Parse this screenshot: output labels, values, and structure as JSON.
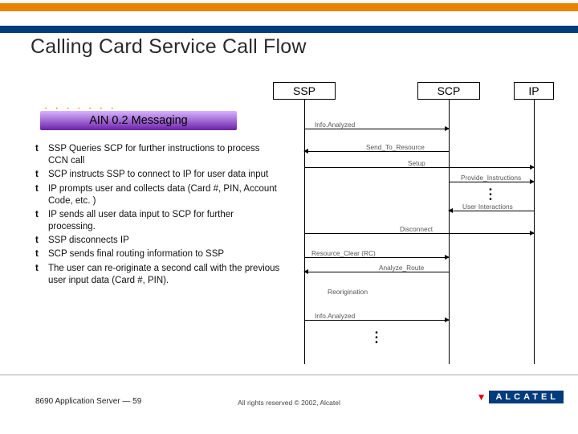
{
  "title": "Calling Card Service Call Flow",
  "subtitle": "AIN 0.2 Messaging",
  "actors": {
    "ssp": "SSP",
    "scp": "SCP",
    "ip": "IP"
  },
  "bullets": [
    "SSP Queries SCP for further instructions to process CCN call",
    "SCP instructs SSP to connect to IP for user data input",
    "IP prompts user and collects data (Card #, PIN, Account Code, etc. )",
    "IP sends all user data input to SCP for further processing.",
    "SSP disconnects IP",
    "SCP sends final routing information to SSP",
    "The user can re-originate a second call with the previous user input data (Card #, PIN)."
  ],
  "messages": {
    "m1": "Info.Analyzed",
    "m2": "Send_To_Resource",
    "m3": "Setup",
    "m4": "Provide_Instructions",
    "m5": "User Interactions",
    "m6": "Disconnect",
    "m7": "Resource_Clear (RC)",
    "m8": "Analyze_Route",
    "m9": "Info.Analyzed"
  },
  "reoriginate_label": "Reorigination",
  "footer_left": "8690 Application Server — 59",
  "footer_center": "All rights reserved © 2002, Alcatel",
  "logo_text": "ALCATEL"
}
